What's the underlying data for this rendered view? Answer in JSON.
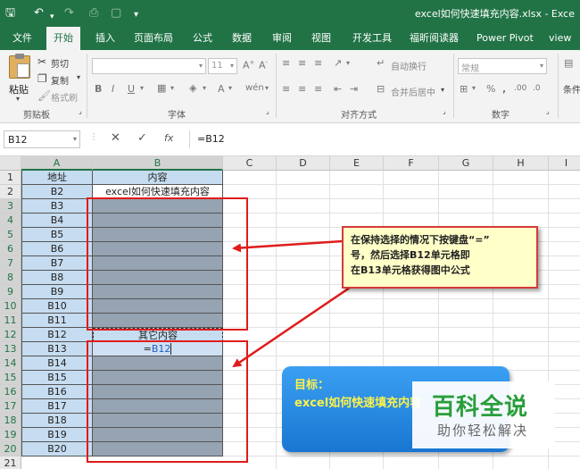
{
  "titlebar": {
    "title": "excel如何快速填充内容.xlsx  -  Exce"
  },
  "tabs": [
    {
      "label": "文件"
    },
    {
      "label": "开始"
    },
    {
      "label": "插入"
    },
    {
      "label": "页面布局"
    },
    {
      "label": "公式"
    },
    {
      "label": "数据"
    },
    {
      "label": "审阅"
    },
    {
      "label": "视图"
    },
    {
      "label": "开发工具"
    },
    {
      "label": "福昕阅读器"
    },
    {
      "label": "Power Pivot"
    },
    {
      "label": "view"
    }
  ],
  "ribbon": {
    "paste_label": "粘贴",
    "cut_label": "剪切",
    "copy_label": "复制",
    "format_painter_label": "格式刷",
    "clipboard_group": "剪贴板",
    "font_size": "11",
    "font_group": "字体",
    "wrap_text_label": "自动换行",
    "merge_center_label": "合并后居中",
    "align_group": "对齐方式",
    "number_format": "常规",
    "number_group": "数字",
    "conditional_label": "条件"
  },
  "formula_bar": {
    "name_box": "B12",
    "formula": "=B12"
  },
  "columns": [
    "A",
    "B",
    "C",
    "D",
    "E",
    "F",
    "G",
    "H",
    "I"
  ],
  "rows": [
    {
      "num": "1",
      "a": "地址",
      "b": "内容"
    },
    {
      "num": "2",
      "a": "B2",
      "b": "excel如何快速填充内容"
    },
    {
      "num": "3",
      "a": "B3",
      "b": ""
    },
    {
      "num": "4",
      "a": "B4",
      "b": ""
    },
    {
      "num": "5",
      "a": "B5",
      "b": ""
    },
    {
      "num": "6",
      "a": "B6",
      "b": ""
    },
    {
      "num": "7",
      "a": "B7",
      "b": ""
    },
    {
      "num": "8",
      "a": "B8",
      "b": ""
    },
    {
      "num": "9",
      "a": "B9",
      "b": ""
    },
    {
      "num": "10",
      "a": "B10",
      "b": ""
    },
    {
      "num": "11",
      "a": "B11",
      "b": ""
    },
    {
      "num": "12",
      "a": "B12",
      "b": "其它内容"
    },
    {
      "num": "13",
      "a": "B13",
      "b": "=B12"
    },
    {
      "num": "14",
      "a": "B14",
      "b": ""
    },
    {
      "num": "15",
      "a": "B15",
      "b": ""
    },
    {
      "num": "16",
      "a": "B16",
      "b": ""
    },
    {
      "num": "17",
      "a": "B17",
      "b": ""
    },
    {
      "num": "18",
      "a": "B18",
      "b": ""
    },
    {
      "num": "19",
      "a": "B19",
      "b": ""
    },
    {
      "num": "20",
      "a": "B20",
      "b": ""
    },
    {
      "num": "21",
      "a": "",
      "b": ""
    }
  ],
  "callout": {
    "line1": "在保持选择的情况下按键盘“=”",
    "line2": "号，然后选择B12单元格即",
    "line3": "在B13单元格获得图中公式"
  },
  "goal": {
    "line1": "目标：",
    "line2": "excel如何快速填充内容"
  },
  "watermark": {
    "line1": "百科全说",
    "line2": "助你轻松解决"
  },
  "colors": {
    "excel_green": "#217346",
    "annotation_red": "#e01b1b",
    "fill_gray": "#95a3b3",
    "header_blue": "#c6dcf0"
  }
}
